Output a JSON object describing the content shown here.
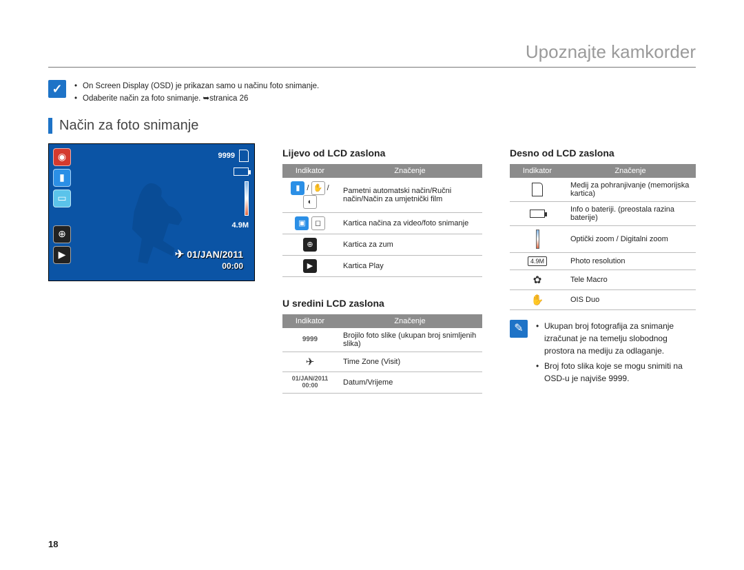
{
  "page": {
    "title": "Upoznajte kamkorder",
    "number": "18"
  },
  "intro": {
    "items": [
      "On Screen Display (OSD) je prikazan samo u načinu foto snimanje.",
      "Odaberite način za foto snimanje. ➥stranica 26"
    ]
  },
  "section_heading": "Način za foto snimanje",
  "lcd": {
    "date": "01/JAN/2011",
    "time": "00:00",
    "counter": "9999",
    "resolution": "4.9M"
  },
  "tables": {
    "header_indicator": "Indikator",
    "header_meaning": "Značenje",
    "left": {
      "title": "Lijevo od LCD zaslona",
      "rows": [
        {
          "meaning": "Pametni automatski način/Ručni način/Način za umjetnički film"
        },
        {
          "meaning": "Kartica načina za video/foto snimanje"
        },
        {
          "meaning": "Kartica za zum"
        },
        {
          "meaning": "Kartica Play"
        }
      ]
    },
    "center": {
      "title": "U sredini LCD zaslona",
      "rows": [
        {
          "ind": "9999",
          "meaning": "Brojilo foto slike (ukupan broj snimljenih slika)"
        },
        {
          "meaning": "Time Zone (Visit)"
        },
        {
          "ind_line1": "01/JAN/2011",
          "ind_line2": "00:00",
          "meaning": "Datum/Vrijeme"
        }
      ]
    },
    "right": {
      "title": "Desno od LCD zaslona",
      "rows": [
        {
          "meaning": "Medij za pohranjivanje (memorijska kartica)"
        },
        {
          "meaning": "Info o bateriji. (preostala razina baterije)"
        },
        {
          "meaning": "Optički zoom / Digitalni zoom"
        },
        {
          "ind": "4.9M",
          "meaning": "Photo resolution"
        },
        {
          "meaning": "Tele Macro"
        },
        {
          "meaning": "OIS Duo"
        }
      ]
    }
  },
  "notes": {
    "items": [
      "Ukupan broj fotografija za snimanje izračunat je na temelju slobodnog prostora na mediju za odlaganje.",
      "Broj foto slika koje se mogu snimiti na OSD-u je najviše 9999."
    ]
  }
}
